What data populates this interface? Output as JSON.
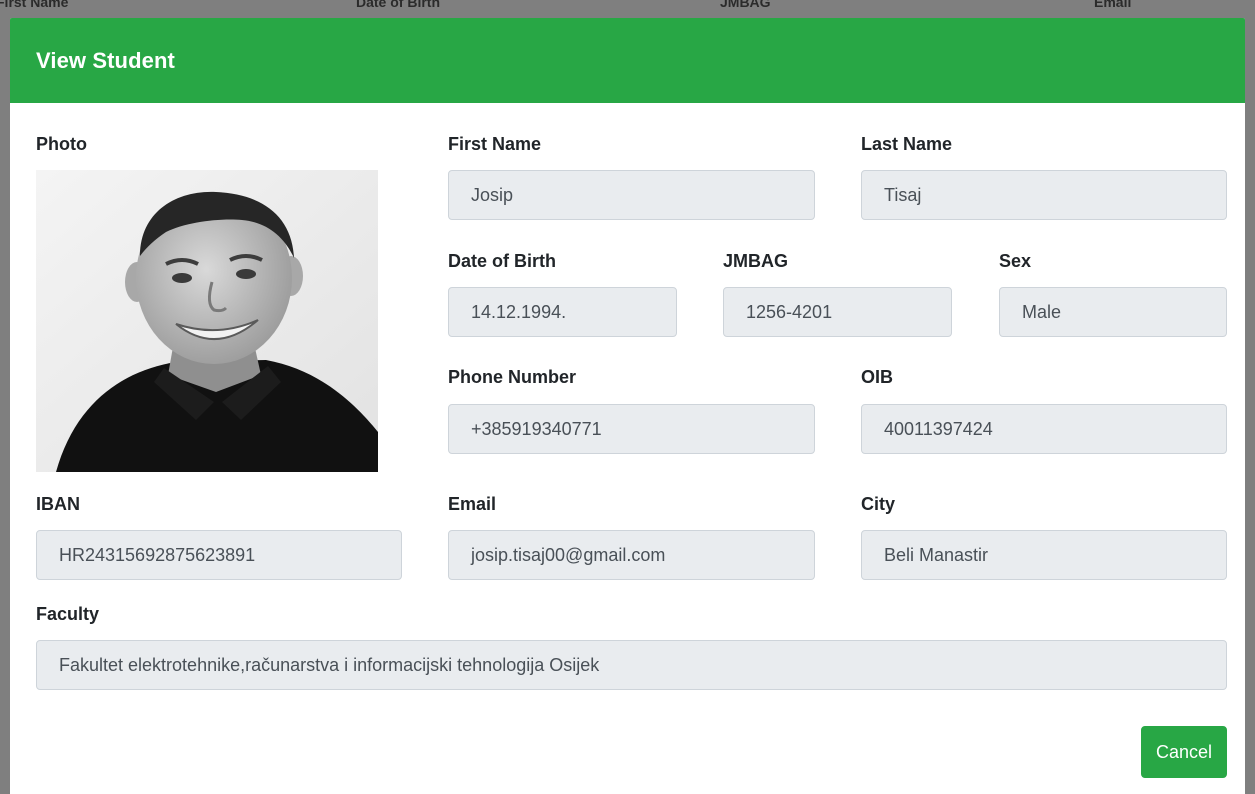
{
  "background_table": {
    "columns": [
      "First Name",
      "Date of Birth",
      "JMBAG",
      "Email"
    ]
  },
  "modal": {
    "title": "View Student",
    "photo_label": "Photo",
    "fields": {
      "first_name": {
        "label": "First Name",
        "value": "Josip"
      },
      "last_name": {
        "label": "Last Name",
        "value": "Tisaj"
      },
      "date_of_birth": {
        "label": "Date of Birth",
        "value": "14.12.1994."
      },
      "jmbag": {
        "label": "JMBAG",
        "value": "1256-4201"
      },
      "sex": {
        "label": "Sex",
        "value": "Male"
      },
      "phone_number": {
        "label": "Phone Number",
        "value": "+385919340771"
      },
      "oib": {
        "label": "OIB",
        "value": "40011397424"
      },
      "iban": {
        "label": "IBAN",
        "value": "HR24315692875623891"
      },
      "email": {
        "label": "Email",
        "value": "josip.tisaj00@gmail.com"
      },
      "city": {
        "label": "City",
        "value": "Beli Manastir"
      },
      "faculty": {
        "label": "Faculty",
        "value": "Fakultet elektrotehnike,računarstva i informacijski tehnologija Osijek"
      }
    },
    "cancel_label": "Cancel"
  },
  "colors": {
    "accent": "#28a745",
    "field_bg": "#e9ecef",
    "field_border": "#ced4da",
    "label_text": "#212529",
    "field_text": "#495057"
  }
}
